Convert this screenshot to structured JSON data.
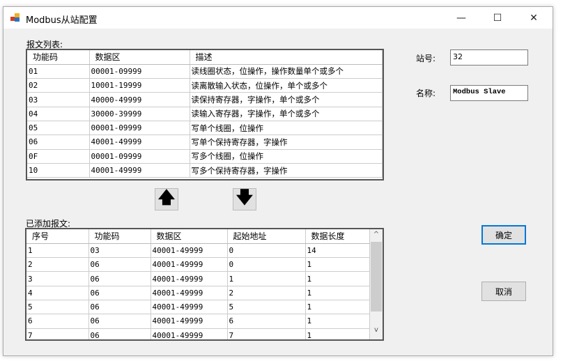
{
  "window": {
    "title": "Modbus从站配置",
    "minimize": "—",
    "maximize": "☐",
    "close": "✕"
  },
  "message_list": {
    "label": "报文列表:",
    "columns": [
      "功能码",
      "数据区",
      "描述"
    ],
    "rows": [
      [
        "01",
        "00001-09999",
        "读线圈状态，位操作，操作数量单个或多个"
      ],
      [
        "02",
        "10001-19999",
        "读离散输入状态，位操作，单个或多个"
      ],
      [
        "03",
        "40000-49999",
        "读保持寄存器，字操作，单个或多个"
      ],
      [
        "04",
        "30000-39999",
        "读输入寄存器，字操作，单个或多个"
      ],
      [
        "05",
        "00001-09999",
        "写单个线圈，位操作"
      ],
      [
        "06",
        "40001-49999",
        "写单个保持寄存器，字操作"
      ],
      [
        "0F",
        "00001-09999",
        "写多个线圈，位操作"
      ],
      [
        "10",
        "40001-49999",
        "写多个保持寄存器，字操作"
      ]
    ]
  },
  "arrows": {
    "up": "🡅",
    "down": "🡇"
  },
  "added_list": {
    "label": "已添加报文:",
    "columns": [
      "序号",
      "功能码",
      "数据区",
      "起始地址",
      "数据长度"
    ],
    "rows": [
      [
        "1",
        "03",
        "40001-49999",
        "0",
        "14"
      ],
      [
        "2",
        "06",
        "40001-49999",
        "0",
        "1"
      ],
      [
        "3",
        "06",
        "40001-49999",
        "1",
        "1"
      ],
      [
        "4",
        "06",
        "40001-49999",
        "2",
        "1"
      ],
      [
        "5",
        "06",
        "40001-49999",
        "5",
        "1"
      ],
      [
        "6",
        "06",
        "40001-49999",
        "6",
        "1"
      ],
      [
        "7",
        "06",
        "40001-49999",
        "7",
        "1"
      ]
    ],
    "scroll_up": "^",
    "scroll_down": "v"
  },
  "station": {
    "label": "站号:",
    "value": "32"
  },
  "name": {
    "label": "名称:",
    "value": "Modbus Slave"
  },
  "buttons": {
    "ok": "确定",
    "cancel": "取消"
  }
}
